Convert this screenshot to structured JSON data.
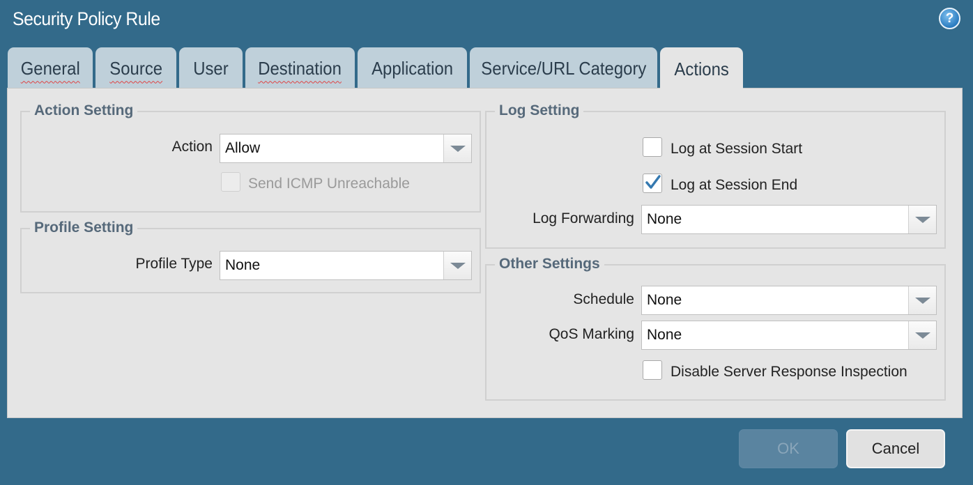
{
  "dialog": {
    "title": "Security Policy Rule",
    "help_icon": "?"
  },
  "tabs": [
    {
      "label": "General"
    },
    {
      "label": "Source"
    },
    {
      "label": "User"
    },
    {
      "label": "Destination"
    },
    {
      "label": "Application"
    },
    {
      "label": "Service/URL Category"
    },
    {
      "label": "Actions"
    }
  ],
  "active_tab": "Actions",
  "action_setting": {
    "legend": "Action Setting",
    "action_label": "Action",
    "action_value": "Allow",
    "send_icmp_label": "Send ICMP Unreachable",
    "send_icmp_checked": false,
    "send_icmp_disabled": true
  },
  "profile_setting": {
    "legend": "Profile Setting",
    "profile_type_label": "Profile Type",
    "profile_type_value": "None"
  },
  "log_setting": {
    "legend": "Log Setting",
    "log_start_label": "Log at Session Start",
    "log_start_checked": false,
    "log_end_label": "Log at Session End",
    "log_end_checked": true,
    "log_forwarding_label": "Log Forwarding",
    "log_forwarding_value": "None"
  },
  "other_settings": {
    "legend": "Other Settings",
    "schedule_label": "Schedule",
    "schedule_value": "None",
    "qos_label": "QoS Marking",
    "qos_value": "None",
    "disable_inspection_label": "Disable Server Response Inspection",
    "disable_inspection_checked": false
  },
  "buttons": {
    "ok_label": "OK",
    "ok_disabled": true,
    "cancel_label": "Cancel"
  },
  "colors": {
    "background": "#336a8a",
    "tab_inactive": "#bfd0da",
    "panel": "#e5e5e5",
    "legend_text": "#56697a",
    "check_mark": "#3579b0"
  }
}
